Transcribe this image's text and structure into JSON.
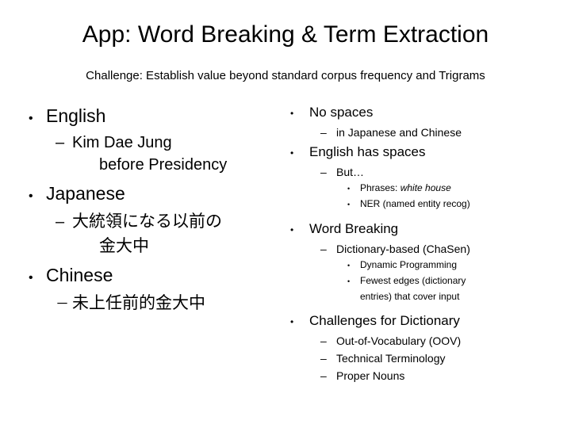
{
  "slide": {
    "title": "App: Word Breaking & Term Extraction",
    "subtitle": "Challenge: Establish value beyond standard corpus frequency and Trigrams",
    "background_color": "#ffffff",
    "text_color": "#000000",
    "bullet_marks": {
      "level1": "•",
      "level2": "–",
      "level2_cjk_thin": "－",
      "level3": "•"
    },
    "left_column": {
      "english_heading": "English",
      "english_example_line1": "Kim Dae Jung",
      "english_example_line2": "before Presidency",
      "japanese_heading": "Japanese",
      "japanese_example_line1": "大統領になる以前の",
      "japanese_example_line2": "金大中",
      "chinese_heading": "Chinese",
      "chinese_example": "未上任前的金大中"
    },
    "right_column": {
      "no_spaces": "No spaces",
      "no_spaces_sub": "in Japanese and Chinese",
      "english_has_spaces": "English has spaces",
      "but": "But…",
      "phrases_prefix": "Phrases: ",
      "phrases_example": "white house",
      "ner": "NER (named entity recog)",
      "word_breaking": "Word Breaking",
      "dictionary_based": "Dictionary-based (ChaSen)",
      "dynamic_programming": "Dynamic Programming",
      "fewest_edges_line1": "Fewest edges (dictionary",
      "fewest_edges_line2": "entries) that cover input",
      "challenges_for_dictionary": "Challenges for Dictionary",
      "oov": "Out-of-Vocabulary (OOV)",
      "technical_terminology": "Technical Terminology",
      "proper_nouns": "Proper Nouns"
    }
  }
}
